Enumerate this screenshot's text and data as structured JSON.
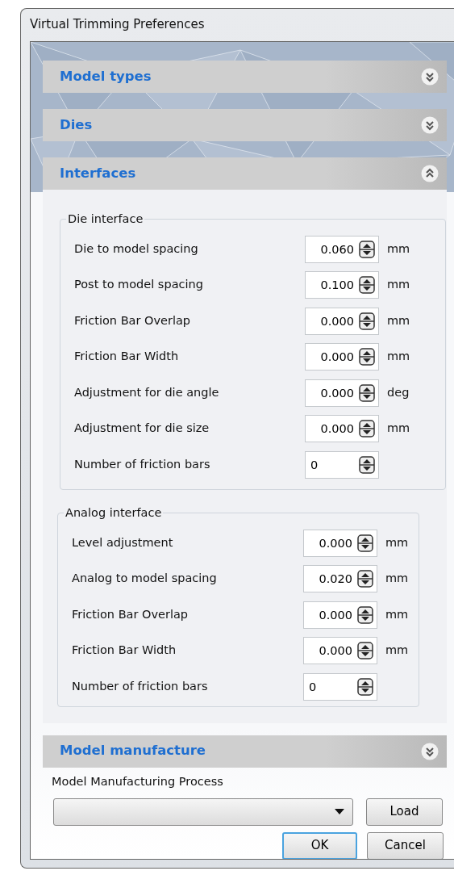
{
  "window": {
    "title": "Virtual Trimming Preferences"
  },
  "sections": [
    {
      "title": "Model types",
      "expanded": false
    },
    {
      "title": "Dies",
      "expanded": false
    },
    {
      "title": "Interfaces",
      "expanded": true,
      "groups": [
        {
          "title": "Die interface",
          "fields": [
            {
              "label": "Die to model spacing",
              "value": "0.060",
              "unit": "mm",
              "kind": "decimal"
            },
            {
              "label": "Post to model spacing",
              "value": "0.100",
              "unit": "mm",
              "kind": "decimal"
            },
            {
              "label": "Friction Bar Overlap",
              "value": "0.000",
              "unit": "mm",
              "kind": "decimal"
            },
            {
              "label": "Friction Bar Width",
              "value": "0.000",
              "unit": "mm",
              "kind": "decimal"
            },
            {
              "label": "Adjustment for die angle",
              "value": "0.000",
              "unit": "deg",
              "kind": "decimal"
            },
            {
              "label": "Adjustment for die size",
              "value": "0.000",
              "unit": "mm",
              "kind": "decimal"
            },
            {
              "label": "Number of friction bars",
              "value": "0",
              "kind": "integer"
            }
          ]
        },
        {
          "title": "Analog interface",
          "fields": [
            {
              "label": "Level adjustment",
              "value": "0.000",
              "unit": "mm",
              "kind": "decimal"
            },
            {
              "label": "Analog to model spacing",
              "value": "0.020",
              "unit": "mm",
              "kind": "decimal"
            },
            {
              "label": "Friction Bar Overlap",
              "value": "0.000",
              "unit": "mm",
              "kind": "decimal"
            },
            {
              "label": "Friction Bar Width",
              "value": "0.000",
              "unit": "mm",
              "kind": "decimal"
            },
            {
              "label": "Number of friction bars",
              "value": "0",
              "kind": "integer"
            }
          ]
        }
      ]
    },
    {
      "title": "Model manufacture",
      "expanded": false
    }
  ],
  "manufacturing": {
    "label": "Model Manufacturing Process",
    "load_button": "Load"
  },
  "buttons": [
    {
      "label": "OK",
      "default": true
    },
    {
      "label": "Cancel",
      "default": false
    }
  ]
}
